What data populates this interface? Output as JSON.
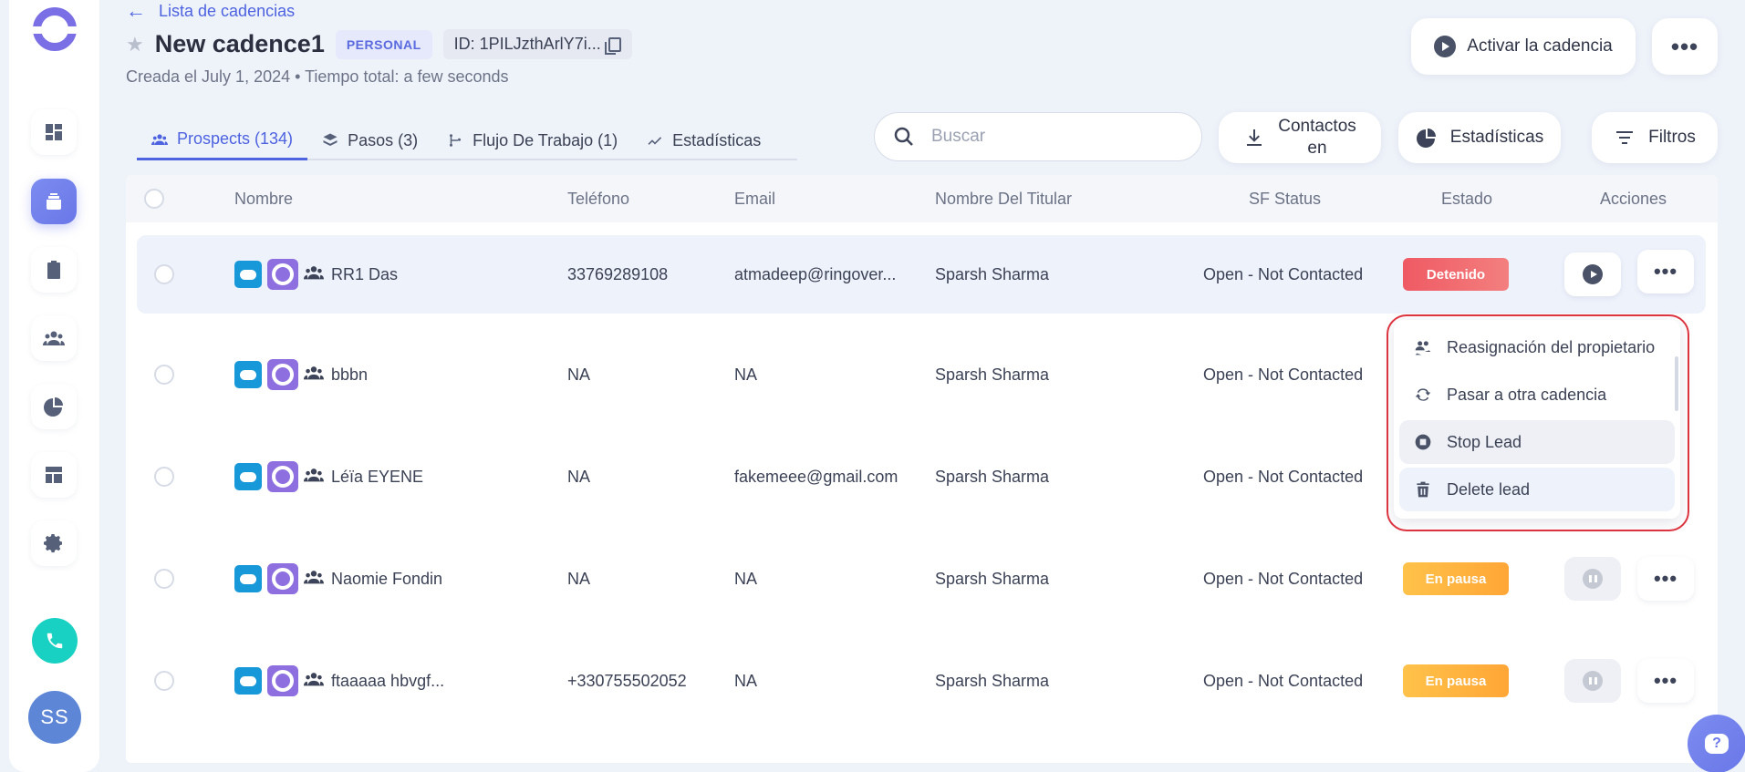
{
  "header": {
    "back_label": "Lista de cadencias",
    "title": "New cadence1",
    "badge": "PERSONAL",
    "id_text": "ID: 1PILJzthArlY7i...",
    "subtitle": "Creada el July 1, 2024 • Tiempo total: a few seconds",
    "activate_label": "Activar la cadencia"
  },
  "sidebar": {
    "avatar_initials": "SS",
    "items": [
      "dashboard-icon",
      "cadence-icon",
      "tasks-icon",
      "people-icon",
      "stats-icon",
      "templates-icon",
      "settings-icon"
    ]
  },
  "tabs": [
    {
      "label": "Prospects (134)"
    },
    {
      "label": "Pasos (3)"
    },
    {
      "label": "Flujo De Trabajo (1)"
    },
    {
      "label": "Estadísticas"
    }
  ],
  "toolbar": {
    "search_placeholder": "Buscar",
    "contacts_label_1": "Contactos",
    "contacts_label_2": "en",
    "stats_label": "Estadísticas",
    "filters_label": "Filtros"
  },
  "table": {
    "columns": [
      "Nombre",
      "Teléfono",
      "Email",
      "Nombre Del Titular",
      "SF Status",
      "Estado",
      "Acciones"
    ],
    "rows": [
      {
        "name": "RR1 Das",
        "phone": "33769289108",
        "email": "atmadeep@ringover...",
        "owner": "Sparsh Sharma",
        "sf_status": "Open - Not Contacted",
        "state": "Detenido",
        "state_type": "stopped"
      },
      {
        "name": "bbbn",
        "phone": "NA",
        "email": "NA",
        "owner": "Sparsh Sharma",
        "sf_status": "Open - Not Contacted",
        "state": "",
        "state_type": "none"
      },
      {
        "name": "Léïa EYENE",
        "phone": "NA",
        "email": "fakemeee@gmail.com",
        "owner": "Sparsh Sharma",
        "sf_status": "Open - Not Contacted",
        "state": "",
        "state_type": "none"
      },
      {
        "name": "Naomie Fondin",
        "phone": "NA",
        "email": "NA",
        "owner": "Sparsh Sharma",
        "sf_status": "Open - Not Contacted",
        "state": "En pausa",
        "state_type": "paused"
      },
      {
        "name": "ftaaaaa hbvgf...",
        "phone": "+330755502052",
        "email": "NA",
        "owner": "Sparsh Sharma",
        "sf_status": "Open - Not Contacted",
        "state": "En pausa",
        "state_type": "paused"
      }
    ]
  },
  "dropdown": {
    "items": [
      {
        "label": "Reasignación del propietario"
      },
      {
        "label": "Pasar a otra cadencia"
      },
      {
        "label": "Stop Lead"
      },
      {
        "label": "Delete lead"
      }
    ]
  },
  "colors": {
    "accent": "#4d63e0",
    "stopped": "#ef5a63",
    "paused": "#ffb23f",
    "highlight_ring": "#e0343f"
  }
}
